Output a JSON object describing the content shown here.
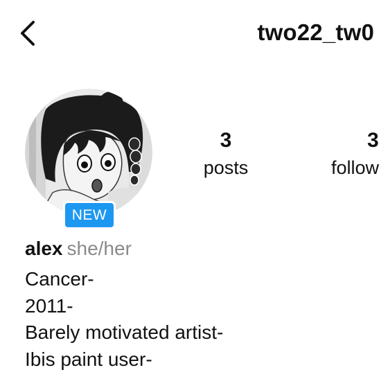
{
  "header": {
    "username": "two22_tw0",
    "back_icon": "chevron-left-icon"
  },
  "profile": {
    "new_badge": "NEW",
    "display_name": "alex",
    "pronouns": "she/her",
    "bio_lines": [
      "Cancer-",
      "2011-",
      "Barely motivated artist-",
      "Ibis paint user-"
    ]
  },
  "stats": {
    "posts": {
      "count": "3",
      "label": "posts"
    },
    "followers": {
      "count": "3",
      "label": "follow"
    }
  },
  "colors": {
    "badge": "#1d98f0",
    "pronouns": "#8a8a8a",
    "text": "#111111"
  }
}
